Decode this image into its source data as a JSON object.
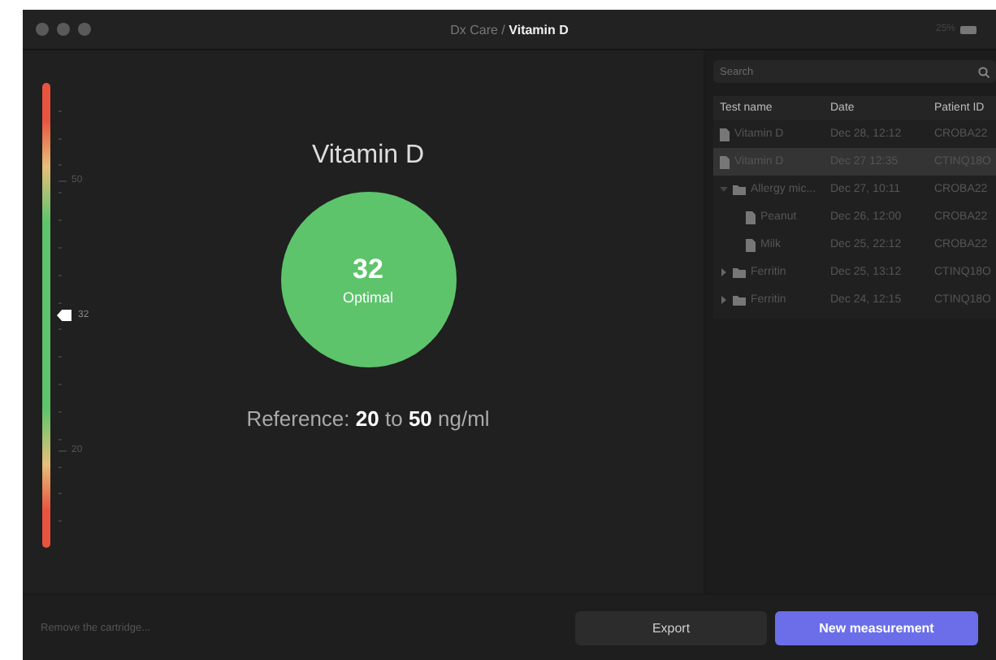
{
  "window": {
    "app": "Dx Care",
    "separator": "/",
    "title": "Vitamin D",
    "battery": "25%"
  },
  "gauge": {
    "labels": [
      "50",
      "20"
    ],
    "marker": "32"
  },
  "result": {
    "title": "Vitamin D",
    "value": "32",
    "status": "Optimal",
    "color": "#5dc46c",
    "reference": "Reference: **20** to **50** ng/ml"
  },
  "search": {
    "placeholder": "Search"
  },
  "table": {
    "columns": [
      "Test name",
      "Date",
      "Patient ID"
    ],
    "rows": [
      {
        "kind": "file",
        "name": "Vitamin D",
        "date": "Dec 28, 12:12",
        "patient": "CROBA22",
        "selected": false
      },
      {
        "kind": "file",
        "name": "Vitamin D",
        "date": "Dec 27 12:35",
        "patient": "CTINQ18O",
        "selected": true
      },
      {
        "kind": "folder",
        "name": "Allergy mic...",
        "date": "Dec 27, 10:11",
        "patient": "CROBA22",
        "selected": false,
        "expanded": true,
        "children": [
          {
            "kind": "file",
            "name": "Peanut",
            "date": "Dec 26, 12:00",
            "patient": "CROBA22",
            "selected": false
          },
          {
            "kind": "file",
            "name": "Milk",
            "date": "Dec 25, 22:12",
            "patient": "CROBA22",
            "selected": false
          }
        ]
      },
      {
        "kind": "folder",
        "name": "Ferritin",
        "date": "Dec 25, 13:12",
        "patient": "CTINQ18O",
        "selected": false,
        "expanded": false
      },
      {
        "kind": "folder",
        "name": "Ferritin",
        "date": "Dec 24, 12:15",
        "patient": "CTINQ18O",
        "selected": false,
        "expanded": false
      }
    ]
  },
  "status": "Remove the cartridge...",
  "buttons": [
    {
      "label": "Export",
      "kind": "secondary"
    },
    {
      "label": "New measurement",
      "kind": "primary"
    }
  ]
}
